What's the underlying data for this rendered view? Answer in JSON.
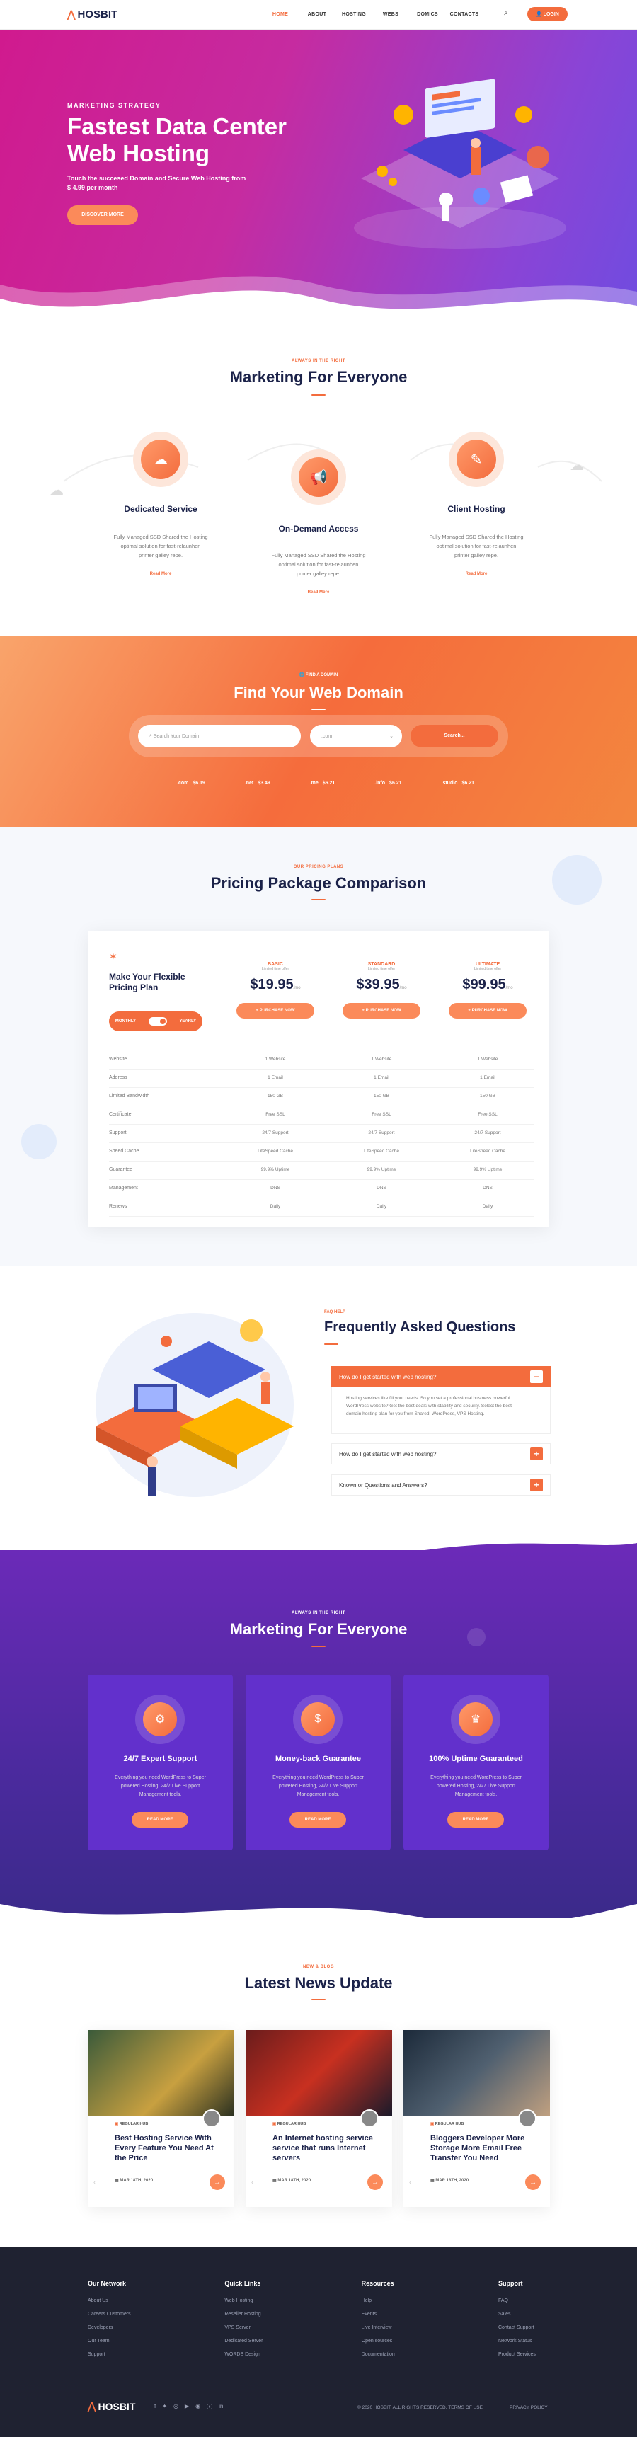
{
  "nav": {
    "brand": "HOSBIT",
    "links": [
      "HOME",
      "ABOUT",
      "HOSTING",
      "WEBS",
      "DOMICS",
      "CONTACTS"
    ],
    "login": "LOGIN"
  },
  "hero": {
    "eyebrow": "MARKETING STRATEGY",
    "title_line1": "Fastest Data Center",
    "title_line2": "Web Hosting",
    "desc_line1": "Touch the succesed Domain and Secure Web Hosting from",
    "desc_line2": "$ 4.99 per month",
    "button": "DISCOVER MORE"
  },
  "marketing": {
    "eyebrow": "ALWAYS IN THE RIGHT",
    "title": "Marketing For Everyone",
    "cards": [
      {
        "title": "Dedicated Service",
        "text1": "Fully Managed SSD Shared the Hosting",
        "text2": "optimal solution for fast-relaunhen",
        "text3": "printer galley repe.",
        "more": "Read More"
      },
      {
        "title": "On-Demand Access",
        "text1": "Fully Managed SSD Shared the Hosting",
        "text2": "optimal solution for fast-relaunhen",
        "text3": "printer galley repe.",
        "more": "Read More"
      },
      {
        "title": "Client Hosting",
        "text1": "Fully Managed SSD Shared the Hosting",
        "text2": "optimal solution for fast-relaunhen",
        "text3": "printer galley repe.",
        "more": "Read More"
      }
    ]
  },
  "domain": {
    "eyebrow": "FIND A DOMAIN",
    "title": "Find Your Web Domain",
    "placeholder": "Search Your Domain",
    "select": ".com",
    "button": "Search...",
    "tlds": [
      {
        "name": ".com",
        "price": "$6.19"
      },
      {
        "name": ".net",
        "price": "$3.49"
      },
      {
        "name": ".me",
        "price": "$6.21"
      },
      {
        "name": ".info",
        "price": "$6.21"
      },
      {
        "name": ".studio",
        "price": "$6.21"
      }
    ]
  },
  "pricing": {
    "eyebrow": "OUR PRICING PLANS",
    "title": "Pricing Package Comparison",
    "intro_line1": "Make Your Flexible",
    "intro_line2": "Pricing Plan",
    "toggle_left": "MONTHLY",
    "toggle_right": "YEARLY",
    "plans": [
      {
        "name": "BASIC",
        "note": "Limited time offer",
        "price": "$19.95",
        "per": "/mo",
        "button": "+ PURCHASE NOW"
      },
      {
        "name": "STANDARD",
        "note": "Limited time offer",
        "price": "$39.95",
        "per": "/mo",
        "button": "+ PURCHASE NOW"
      },
      {
        "name": "ULTIMATE",
        "note": "Limited time offer",
        "price": "$99.95",
        "per": "/mo",
        "button": "+ PURCHASE NOW"
      }
    ],
    "features": [
      {
        "label": "Website",
        "v": [
          "1 Website",
          "1 Website",
          "1 Website"
        ]
      },
      {
        "label": "Address",
        "v": [
          "1 Email",
          "1 Email",
          "1 Email"
        ]
      },
      {
        "label": "Limited Bandwidth",
        "v": [
          "150 GB",
          "150 GB",
          "150 GB"
        ]
      },
      {
        "label": "Certificate",
        "v": [
          "Free SSL",
          "Free SSL",
          "Free SSL"
        ]
      },
      {
        "label": "Support",
        "v": [
          "24/7 Support",
          "24/7 Support",
          "24/7 Support"
        ]
      },
      {
        "label": "Speed Cache",
        "v": [
          "LiteSpeed Cache",
          "LiteSpeed Cache",
          "LiteSpeed Cache"
        ]
      },
      {
        "label": "Guarantee",
        "v": [
          "99.9% Uptime",
          "99.9% Uptime",
          "99.9% Uptime"
        ]
      },
      {
        "label": "Management",
        "v": [
          "DNS",
          "DNS",
          "DNS"
        ]
      },
      {
        "label": "Renews",
        "v": [
          "Daily",
          "Daily",
          "Daily"
        ]
      }
    ]
  },
  "faq": {
    "eyebrow": "FAQ HELP",
    "title": "Frequently Asked Questions",
    "q1": "How do I get started with web hosting?",
    "a1_line1": "Hosting services like fill your needs. So you set a professional business powerful",
    "a1_line2": "WordPress website? Get the best deals with stability and security. Select the best",
    "a1_line3": "domain hosting plan for you from Shared, WordPress, VPS Hosting.",
    "q2": "How do I get started with web hosting?",
    "q3": "Known or Questions and Answers?",
    "toggle_open": "−",
    "toggle_closed": "+"
  },
  "features": {
    "eyebrow": "ALWAYS IN THE RIGHT",
    "title": "Marketing For Everyone",
    "cards": [
      {
        "title": "24/7 Expert Support",
        "text1": "Everything you need WordPress to Super",
        "text2": "powered Hosting, 24/7 Live Support",
        "text3": "Management tools.",
        "button": "READ MORE"
      },
      {
        "title": "Money-back Guarantee",
        "text1": "Everything you need WordPress to Super",
        "text2": "powered Hosting, 24/7 Live Support",
        "text3": "Management tools.",
        "button": "READ MORE"
      },
      {
        "title": "100% Uptime Guaranteed",
        "text1": "Everything you need WordPress to Super",
        "text2": "powered Hosting, 24/7 Live Support",
        "text3": "Management tools.",
        "button": "READ MORE"
      }
    ]
  },
  "news": {
    "eyebrow": "NEW & BLOG",
    "title": "Latest News Update",
    "posts": [
      {
        "tag": "REGULAR HUB",
        "title1": "Best Hosting Service With",
        "title2": "Every Feature You Need At",
        "title3": "the Price",
        "date": "MAR 18TH, 2020"
      },
      {
        "tag": "REGULAR HUB",
        "title1": "An Internet hosting service",
        "title2": "service that runs Internet",
        "title3": "servers",
        "date": "MAR 18TH, 2020"
      },
      {
        "tag": "REGULAR HUB",
        "title1": "Bloggers Developer More",
        "title2": "Storage More Email Free",
        "title3": "Transfer You Need",
        "date": "MAR 18TH, 2020"
      }
    ]
  },
  "footer": {
    "cols": [
      {
        "head": "Our Network",
        "links": [
          "About Us",
          "Careers Customers",
          "Developers",
          "Our Team",
          "Support"
        ]
      },
      {
        "head": "Quick Links",
        "links": [
          "Web Hosting",
          "Reseller Hosting",
          "VPS Server",
          "Dedicated Server",
          "WORDS Design"
        ]
      },
      {
        "head": "Resources",
        "links": [
          "Help",
          "Events",
          "Live Interview",
          "Open sources",
          "Documentation"
        ]
      },
      {
        "head": "Support",
        "links": [
          "FAQ",
          "Sales",
          "Contact Support",
          "Network Status",
          "Product Services"
        ]
      }
    ],
    "brand": "HOSBIT",
    "copyright": "© 2020 HOSBIT. ALL RIGHTS RESERVED. TERMS OF USE",
    "privacy": "PRIVACY POLICY"
  }
}
